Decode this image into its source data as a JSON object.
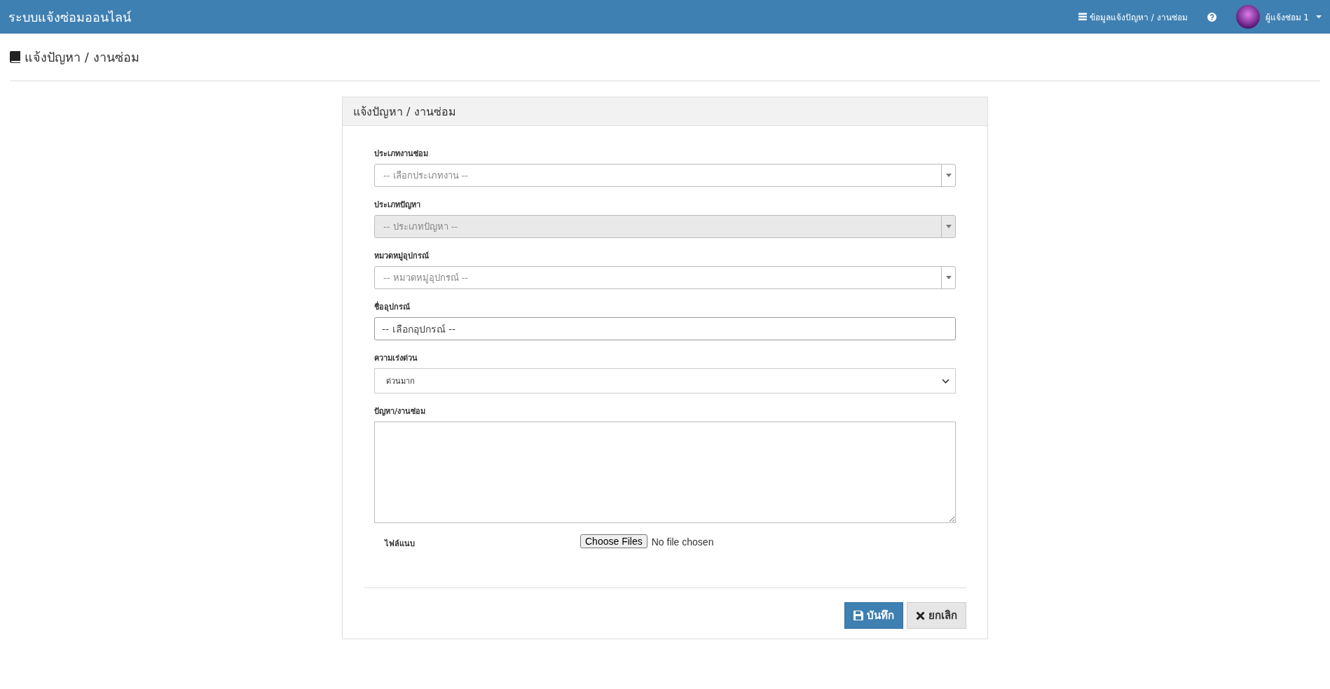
{
  "navbar": {
    "brand": "ระบบแจ้งซ่อมออนไลน์",
    "links": [
      {
        "kind": "list",
        "label": "ข้อมูลแจ้งปัญหา / งานซ่อม"
      },
      {
        "kind": "help"
      }
    ],
    "user": {
      "label": "ผู้แจ้งซ่อม 1"
    }
  },
  "page_title": "แจ้งปัญหา / งานซ่อม",
  "panel": {
    "title": "แจ้งปัญหา / งานซ่อม",
    "fields": [
      {
        "kind": "combo",
        "label": "ประเภทงานซ่อม",
        "placeholder": "-- เลือกประเภทงาน --",
        "disabled": false
      },
      {
        "kind": "combo",
        "label": "ประเภทปัญหา",
        "placeholder": "-- ประเภทปัญหา --",
        "disabled": true
      },
      {
        "kind": "combo",
        "label": "หมวดหมู่อุปกรณ์",
        "placeholder": "-- หมวดหมู่อุปกรณ์ --",
        "disabled": false
      },
      {
        "kind": "input",
        "label": "ชื่ออุปกรณ์",
        "placeholder": "-- เลือกอุปกรณ์ --"
      },
      {
        "kind": "select",
        "label": "ความเร่งด่วน",
        "value": "ด่วนมาก"
      },
      {
        "kind": "textarea",
        "label": "ปัญหา/งานซ่อม"
      },
      {
        "kind": "file",
        "label": "ไฟล์แนบ",
        "button": "Choose Files",
        "status": "No file chosen"
      }
    ],
    "buttons": [
      {
        "kind": "save",
        "label": "บันทึก"
      },
      {
        "kind": "cancel",
        "label": "ยกเลิก"
      }
    ]
  }
}
